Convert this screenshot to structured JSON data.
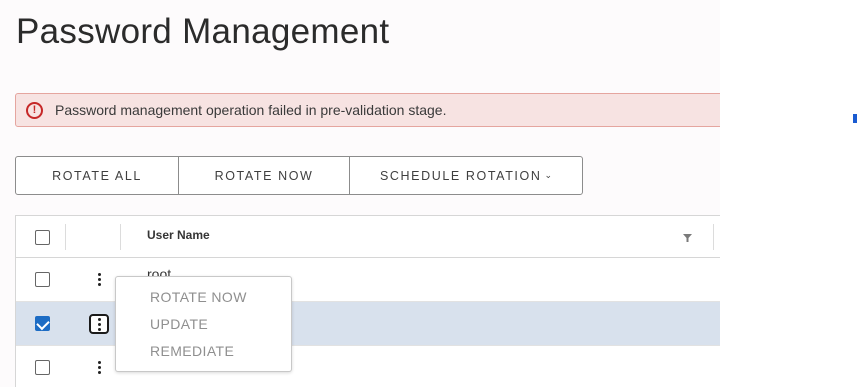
{
  "page": {
    "title": "Password Management"
  },
  "alert": {
    "icon": "alert-circle-icon",
    "message": "Password management operation failed in pre-validation stage.",
    "colors": {
      "background": "#f7e3e2",
      "border": "#e5a59f",
      "icon": "#c62828"
    }
  },
  "toolbar": {
    "rotate_all": "ROTATE ALL",
    "rotate_now": "ROTATE NOW",
    "schedule_rotation": "SCHEDULE ROTATION"
  },
  "grid": {
    "columns": {
      "user_name": "User Name"
    },
    "rows": [
      {
        "user_name": "root",
        "selected": false
      },
      {
        "user_name": "",
        "selected": true
      },
      {
        "user_name": "",
        "selected": false
      }
    ]
  },
  "context_menu": {
    "items": [
      "ROTATE NOW",
      "UPDATE",
      "REMEDIATE"
    ]
  },
  "colors": {
    "accent": "#1d6cc4",
    "selected_row": "#d8e1ed"
  }
}
